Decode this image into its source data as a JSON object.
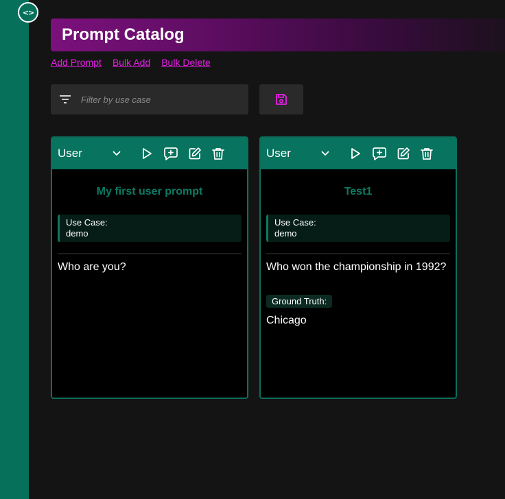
{
  "sidebar": {
    "toggle_label": "<>"
  },
  "header": {
    "title": "Prompt Catalog"
  },
  "actions": {
    "add_prompt": "Add Prompt",
    "bulk_add": "Bulk Add",
    "bulk_delete": "Bulk Delete"
  },
  "filter": {
    "placeholder": "Filter by use case",
    "value": ""
  },
  "colors": {
    "accent_teal": "#08735e",
    "accent_magenta": "#e61ee6",
    "title_gradient_start": "#7b117c"
  },
  "icons": {
    "filter": "filter-icon",
    "save": "save-icon",
    "run": "play-icon",
    "add_message": "add-comment-icon",
    "edit": "edit-icon",
    "delete": "trash-icon",
    "dropdown": "chevron-down-icon"
  },
  "cards": [
    {
      "role": "User",
      "title": "My first user prompt",
      "use_case_label": "Use Case:",
      "use_case": "demo",
      "prompt": "Who are you?"
    },
    {
      "role": "User",
      "title": "Test1",
      "use_case_label": "Use Case:",
      "use_case": "demo",
      "prompt": "Who won the championship in 1992?",
      "ground_truth_label": "Ground Truth:",
      "ground_truth": "Chicago"
    }
  ]
}
